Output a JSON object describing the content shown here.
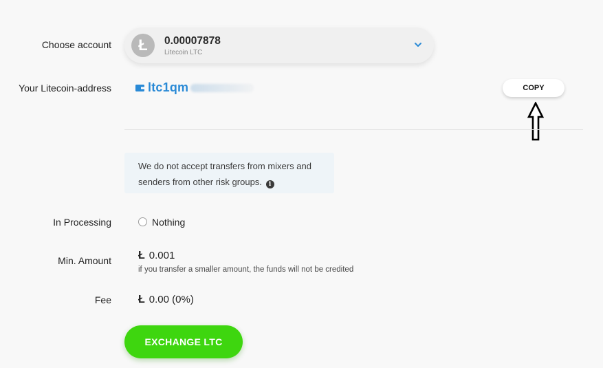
{
  "account": {
    "label": "Choose account",
    "balance": "0.00007878",
    "currency": "Litecoin LTC",
    "logo_glyph": "Ł",
    "logo_icon": "litecoin-icon",
    "dropdown_icon": "chevron-down-icon"
  },
  "address": {
    "label": "Your Litecoin-address",
    "value": "ltc1qm",
    "icon": "wallet-icon",
    "copy_label": "COPY"
  },
  "notice": {
    "text": "We do not accept transfers from mixers and senders from other risk groups.",
    "icon_glyph": "i"
  },
  "processing": {
    "label": "In Processing",
    "value": "Nothing"
  },
  "min_amount": {
    "label": "Min. Amount",
    "symbol": "Ł",
    "value": "0.001",
    "hint": "if you transfer a smaller amount, the funds will not be credited"
  },
  "fee": {
    "label": "Fee",
    "symbol": "Ł",
    "value": "0.00 (0%)"
  },
  "exchange_button": "EXCHANGE LTC",
  "colors": {
    "accent_green": "#3ed60f",
    "address_blue": "#2a8ad6",
    "notice_bg": "#eef4f8"
  }
}
